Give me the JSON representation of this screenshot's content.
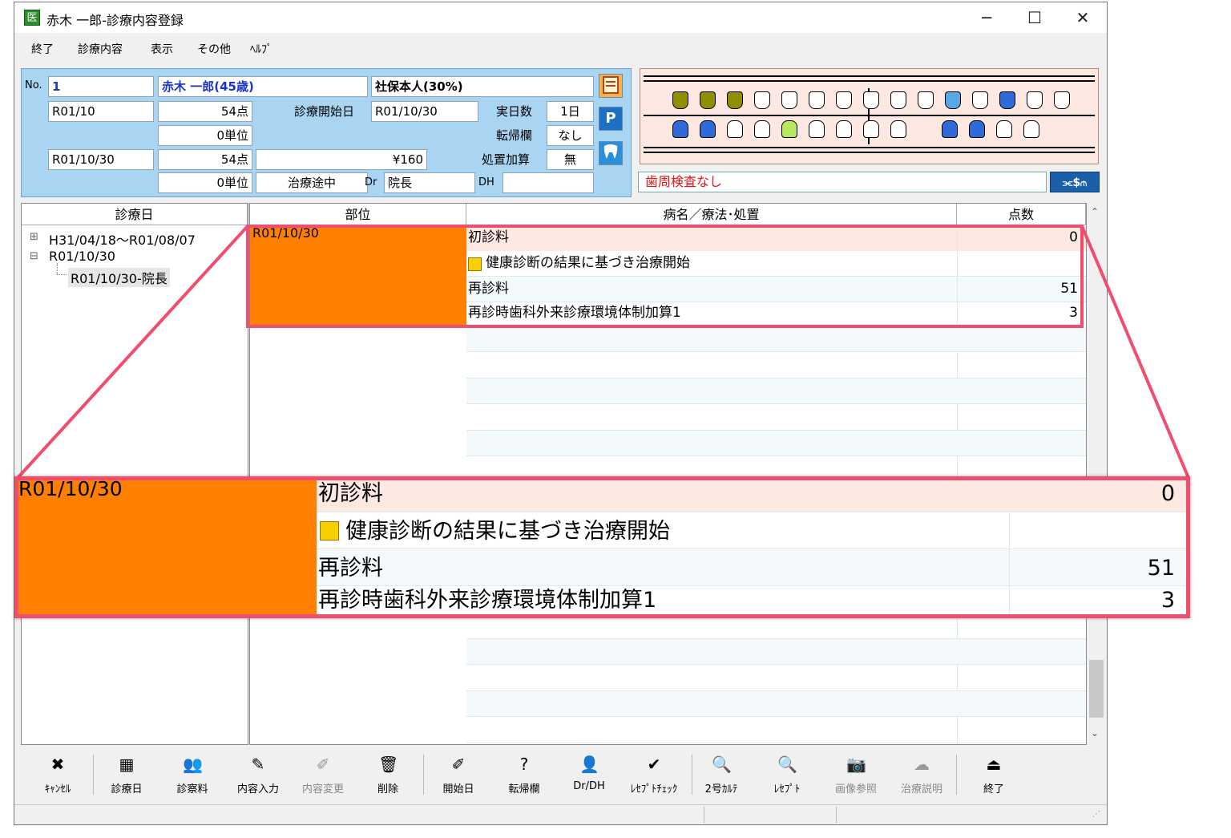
{
  "window": {
    "title": "赤木 一郎-診療内容登録",
    "app_icon": "clinic-app-icon",
    "controls": {
      "minimize": "─",
      "maximize": "☐",
      "close": "✕"
    }
  },
  "menu": [
    {
      "label": "終了"
    },
    {
      "label": "診療内容"
    },
    {
      "label": "表示"
    },
    {
      "label": "その他"
    },
    {
      "label": "ﾍﾙﾌﾟ"
    }
  ],
  "patient": {
    "no_label": "No.",
    "no": "1",
    "name": "赤木 一郎(45歳)",
    "insurance": "社保本人(30%)",
    "row2_date": "R01/10",
    "row2_points": "54点",
    "start_label": "診療開始日",
    "start_date": "R01/10/30",
    "days_label": "実日数",
    "days": "1日",
    "row3_units": "0単位",
    "transfer_label": "転帰欄",
    "transfer": "なし",
    "row4_date": "R01/10/30",
    "row4_points": "54点",
    "amount": "¥160",
    "treat_add_label": "処置加算",
    "treat_add": "無",
    "row5_units": "0単位",
    "status": "治療途中",
    "dr_label": "Dr",
    "dr": "院長",
    "dh_label": "DH",
    "dh": ""
  },
  "side_buttons": {
    "b2": "P"
  },
  "perio": {
    "text": "歯周検査なし",
    "button": "⫘$⫙"
  },
  "colors": {
    "orange": "#ff7f00",
    "olive": "#8f8f00",
    "blue": "#2f6bd8",
    "light_blue": "#58a8e8",
    "light_green": "#b8e860",
    "pink_row": "#fde8e2",
    "highlight": "#f04e6f"
  },
  "left_list": {
    "header": "診療日",
    "items": [
      {
        "label": "H31/04/18〜R01/08/07",
        "expander": "⊞"
      },
      {
        "label": "R01/10/30",
        "expander": "⊟"
      },
      {
        "label": "R01/10/30-院長",
        "expander": ""
      }
    ]
  },
  "grid": {
    "headers": {
      "part": "部位",
      "name": "病名／療法･処置",
      "points": "点数"
    },
    "part_value": "R01/10/30",
    "rows": [
      {
        "name": "初診料",
        "points": "0"
      },
      {
        "name": "健康診断の結果に基づき治療開始",
        "points": ""
      },
      {
        "name": "再診料",
        "points": "51"
      },
      {
        "name": "再診時歯科外来診療環境体制加算1",
        "points": "3"
      }
    ]
  },
  "toolbar": [
    {
      "label": "ｷｬﾝｾﾙ",
      "icon": "✖"
    },
    {
      "label": "診療日",
      "icon": "▦"
    },
    {
      "label": "診察料",
      "icon": "👥"
    },
    {
      "label": "内容入力",
      "icon": "✎"
    },
    {
      "label": "内容変更",
      "icon": "✐"
    },
    {
      "label": "削除",
      "icon": "🗑"
    },
    {
      "label": "開始日",
      "icon": "✐"
    },
    {
      "label": "転帰欄",
      "icon": "?"
    },
    {
      "label": "Dr/DH",
      "icon": "👤"
    },
    {
      "label": "ﾚｾﾌﾟﾄﾁｪｯｸ",
      "icon": "✔"
    },
    {
      "label": "2号ｶﾙﾃ",
      "icon": "🔍"
    },
    {
      "label": "ﾚｾﾌﾟﾄ",
      "icon": "🔍"
    },
    {
      "label": "画像参照",
      "icon": "📷"
    },
    {
      "label": "治療説明",
      "icon": "☁"
    },
    {
      "label": "終了",
      "icon": "⏏"
    }
  ]
}
